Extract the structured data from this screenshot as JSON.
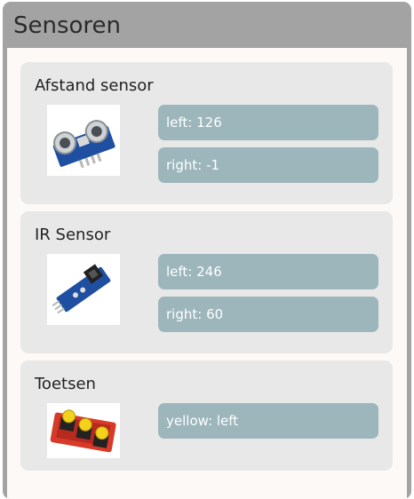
{
  "panel": {
    "title": "Sensoren"
  },
  "sensors": [
    {
      "title": "Afstand sensor",
      "image_icon": "ultrasonic-sensor-icon",
      "readings": [
        {
          "label": "left: 126"
        },
        {
          "label": "right: -1"
        }
      ]
    },
    {
      "title": "IR Sensor",
      "image_icon": "ir-sensor-icon",
      "readings": [
        {
          "label": "left: 246"
        },
        {
          "label": "right: 60"
        }
      ]
    },
    {
      "title": "Toetsen",
      "image_icon": "buttons-module-icon",
      "readings": [
        {
          "label": "yellow: left"
        }
      ]
    }
  ],
  "colors": {
    "header": "#a3a3a3",
    "card": "#e8e8e8",
    "reading_box": "#9cb6bc",
    "body": "#fcf9f7"
  }
}
